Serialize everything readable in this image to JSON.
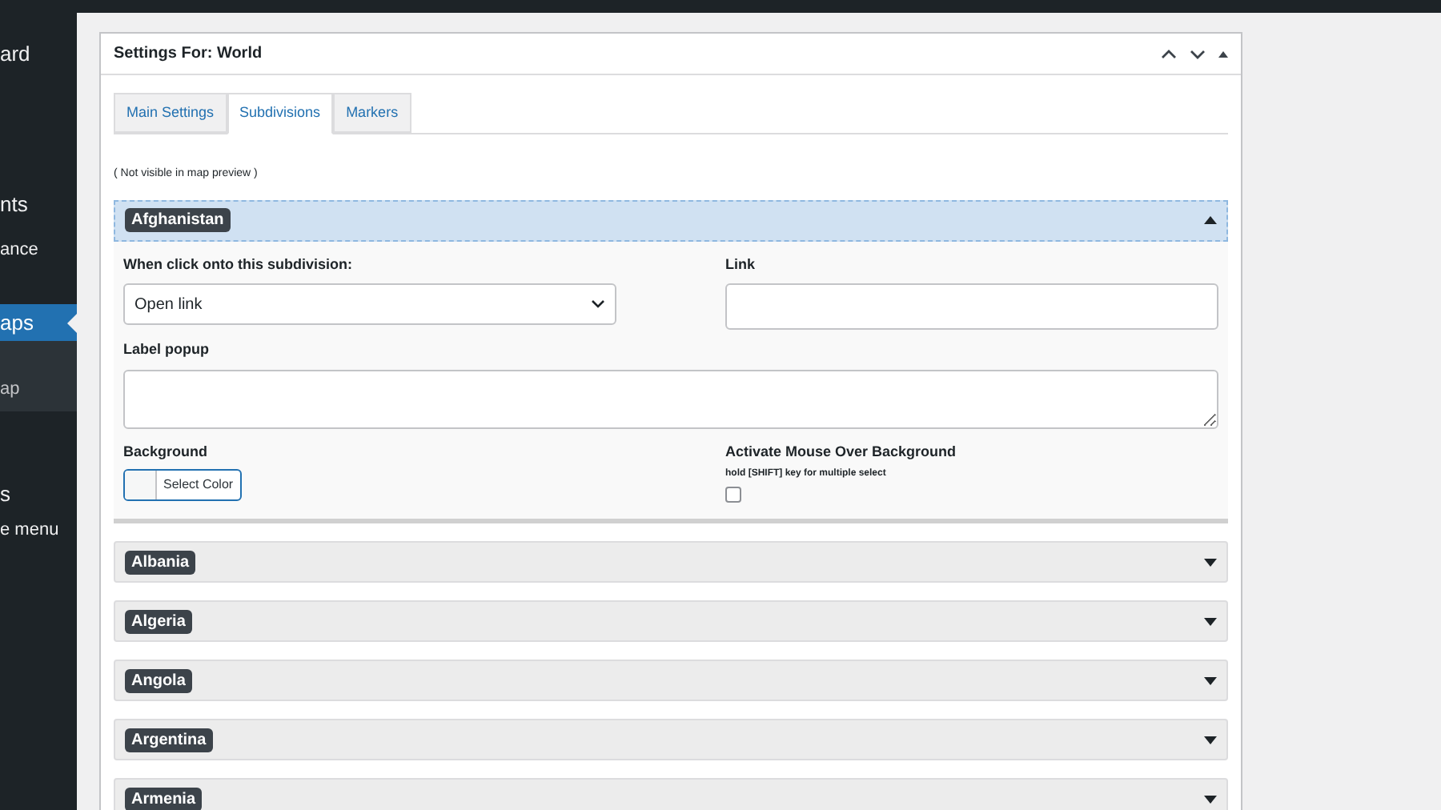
{
  "sidebar": {
    "items": [
      {
        "label": "ard",
        "kind": "item"
      },
      {
        "label": "nts",
        "kind": "item"
      },
      {
        "label": "ance",
        "kind": "item"
      },
      {
        "label": "aps",
        "kind": "current"
      },
      {
        "label": "ap",
        "kind": "submenu"
      },
      {
        "label": "s",
        "kind": "item"
      },
      {
        "label": "e menu",
        "kind": "item"
      }
    ]
  },
  "panel": {
    "title": "Settings For: World",
    "tabs": [
      {
        "label": "Main Settings",
        "selected": false
      },
      {
        "label": "Subdivisions",
        "selected": true
      },
      {
        "label": "Markers",
        "selected": false
      }
    ],
    "note": "( Not visible in map preview )",
    "subdivisions": [
      {
        "name": "Afghanistan",
        "expanded": true,
        "form": {
          "click_label": "When click onto this subdivision:",
          "click_value": "Open link",
          "link_label": "Link",
          "popup_label": "Label popup",
          "background_label": "Background",
          "color_button": "Select Color",
          "hover_label": "Activate Mouse Over Background",
          "hover_hint": "hold [SHIFT] key for multiple select",
          "hover_checked": false
        }
      },
      {
        "name": "Albania",
        "expanded": false
      },
      {
        "name": "Algeria",
        "expanded": false
      },
      {
        "name": "Angola",
        "expanded": false
      },
      {
        "name": "Argentina",
        "expanded": false
      },
      {
        "name": "Armenia",
        "expanded": false
      }
    ]
  }
}
